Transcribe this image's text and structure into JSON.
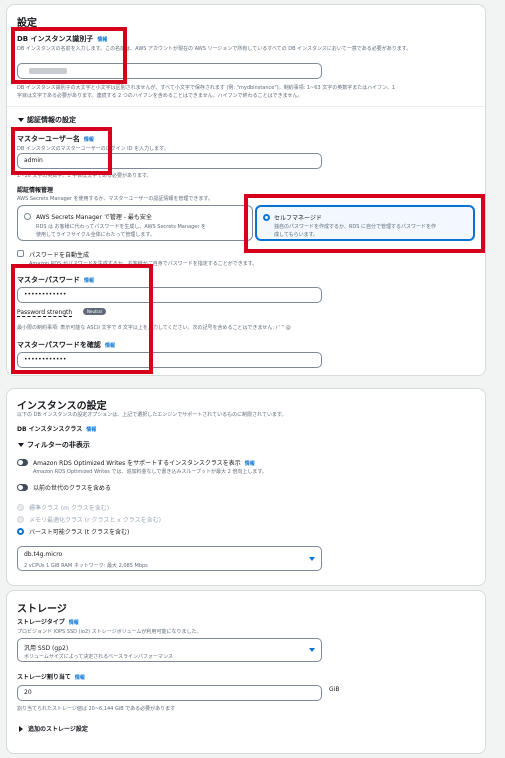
{
  "settings": {
    "title": "設定",
    "db_identifier": {
      "label": "DB インスタンス識別子",
      "info": "情報",
      "description": "DB インスタンスの名前を入力します。この名前は、AWS アカウントが現在の AWS リージョンで所有しているすべての DB インスタンスにおいて一意である必要があります。",
      "value": "",
      "constraints_1": "DB インスタンス識別子の大文字と小文字は区別されませんが、すべて小文字で保存されます (例: \"mydbinstance\")。制約事項: 1~63 文字の英数字またはハイフン。1",
      "constraints_2": "字目は文字である必要があります。連続する 2 つのハイフンを含めることはできません。ハイフンで終わることはできません。"
    },
    "credentials_section": "認証情報の設定",
    "master_username": {
      "label": "マスターユーザー名",
      "info": "情報",
      "description": "DB インスタンスのマスターユーザーのログイン ID を入力します。",
      "value": "admin",
      "hint": "1~16 文字の英数字。1 字目は文字である必要があります。"
    },
    "credentials_management": {
      "label": "認証情報管理",
      "description": "AWS Secrets Manager を使用するか、マスターユーザーの認証情報を管理できます。",
      "options": [
        {
          "title": "AWS Secrets Manager で管理 - 最も安全",
          "desc_1": "RDS は お客様に代わってパスワードを生成し、AWS Secrets Manager を",
          "desc_2": "使用してライフサイクル全体にわたって管理します。"
        },
        {
          "title": "セルフマネージド",
          "desc_1": "独自のパスワードを作成するか、RDS に自分で管理するパスワードを作",
          "desc_2": "成してもらいます。"
        }
      ]
    },
    "auto_password": {
      "label": "パスワードを自動生成",
      "description": "Amazon RDS がパスワードを生成するか、お客様がご自身でパスワードを指定することができます。"
    },
    "master_password": {
      "label": "マスターパスワード",
      "info": "情報",
      "value": "••••••••••••",
      "strength_label": "Password strength",
      "strength_badge": "Neutral",
      "constraints": "最小限の制約事項: 表示可能な ASCII 文字で 8 文字以上を入力してください。次の記号を含めることはできません: / ' \" @"
    },
    "confirm_password": {
      "label": "マスターパスワードを確認",
      "info": "情報",
      "value": "••••••••••••"
    }
  },
  "instance": {
    "title": "インスタンスの設定",
    "description": "以下の DB インスタンスの設定オプションは、上記で選択したエンジンでサポートされているものに制限されています。",
    "class_label": "DB インスタンスクラス",
    "info": "情報",
    "filter_label": "フィルターの非表示",
    "optimized_writes_label": "Amazon RDS Optimized Writes をサポートするインスタンスクラスを表示",
    "optimized_writes_info": "情報",
    "optimized_writes_desc": "Amazon RDS Optimized Writes では、追加料金なしで書き込みスループットが最大 2 倍向上します。",
    "previous_gen_label": "以前の世代のクラスを含める",
    "class_options": [
      "標準クラス (m クラスを含む)",
      "メモリ最適化クラス (r クラスと x クラスを含む)",
      "バースト可能クラス (t クラスを含む)"
    ],
    "selected_class": "db.t4g.micro",
    "selected_class_detail": "2 vCPUs    1 GiB RAM    ネットワーク: 最大 2,085 Mbps"
  },
  "storage": {
    "title": "ストレージ",
    "type_label": "ストレージタイプ",
    "type_info": "情報",
    "type_desc": "プロビジョンド IOPS SSD (io2) ストレージボリュームが利用可能になりました。",
    "type_value": "汎用 SSD (gp2)",
    "type_value_desc": "ボリュームサイズによって決定されるベースラインパフォーマンス",
    "alloc_label": "ストレージ割り当て",
    "alloc_info": "情報",
    "alloc_value": "20",
    "alloc_unit": "GiB",
    "alloc_hint": "割り当てられたストレージ値は 20~6,144 GiB である必要があります",
    "additional": "追加のストレージ設定"
  },
  "colors": {
    "accent": "#0972d3",
    "highlight": "#d6001c",
    "text": "#16191f"
  }
}
